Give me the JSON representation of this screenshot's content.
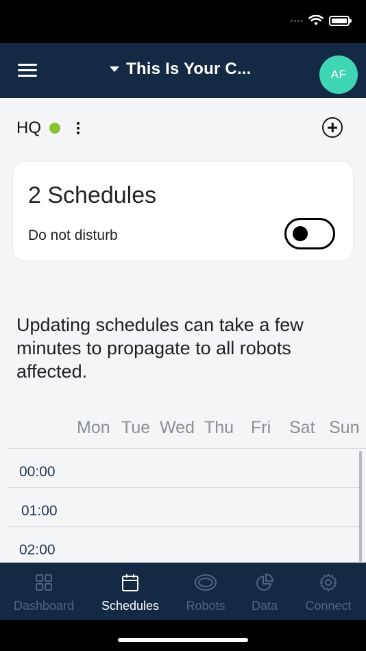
{
  "header": {
    "title": "This Is Your C...",
    "avatar_initials": "AF"
  },
  "site": {
    "name": "HQ",
    "status_color": "#86c232"
  },
  "schedules_card": {
    "title": "2 Schedules",
    "do_not_disturb_label": "Do not disturb",
    "do_not_disturb_enabled": false
  },
  "info_text": "Updating schedules can take a few minutes to propagate to all robots affected.",
  "calendar": {
    "days": [
      "Mon",
      "Tue",
      "Wed",
      "Thu",
      "Fri",
      "Sat",
      "Sun"
    ],
    "times": [
      "00:00",
      "01:00",
      "02:00"
    ]
  },
  "tabs": [
    {
      "label": "Dashboard",
      "icon": "grid-icon",
      "active": false
    },
    {
      "label": "Schedules",
      "icon": "calendar-icon",
      "active": true
    },
    {
      "label": "Robots",
      "icon": "robot-vacuum-icon",
      "active": false
    },
    {
      "label": "Data",
      "icon": "pie-chart-icon",
      "active": false
    },
    {
      "label": "Connect",
      "icon": "gear-icon",
      "active": false
    }
  ],
  "colors": {
    "header_bg": "#142a44",
    "avatar_bg": "#3fd6b5",
    "tab_inactive": "#4f6580",
    "tab_active": "#ffffff"
  }
}
